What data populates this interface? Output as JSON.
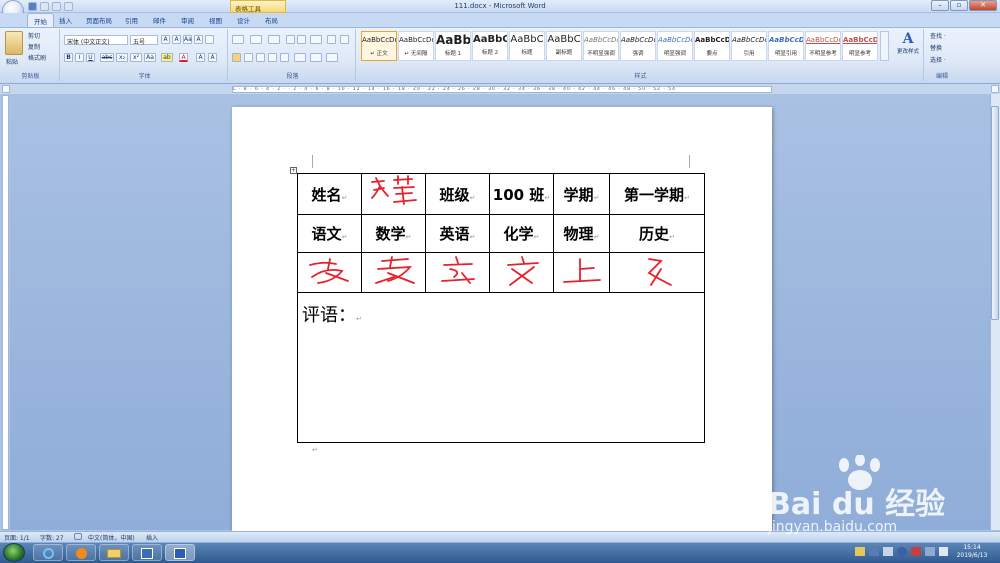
{
  "window": {
    "title": "111.docx - Microsoft Word",
    "context_tab": "表格工具",
    "minimize": "–",
    "restore": "▫",
    "close": "✕"
  },
  "tabs": [
    "开始",
    "插入",
    "页面布局",
    "引用",
    "邮件",
    "审阅",
    "视图",
    "设计",
    "布局"
  ],
  "clipboard": {
    "paste": "粘贴",
    "cut": "剪切",
    "copy": "复制",
    "format_painter": "格式刷",
    "label": "剪贴板"
  },
  "font": {
    "name": "宋体 (中文正文)",
    "size": "五号",
    "label": "字体",
    "bold": "B",
    "italic": "I",
    "underline": "U",
    "strike": "abc",
    "sub": "x₂",
    "sup": "x²",
    "aa": "Aa",
    "grow": "A",
    "shrink": "A",
    "clear": "A",
    "highlight": "ab",
    "color": "A",
    "char_border": "A"
  },
  "paragraph": {
    "label": "段落"
  },
  "styles": {
    "label": "样式",
    "items": [
      {
        "sample": "AaBbCcDd",
        "name": "↵ 正文"
      },
      {
        "sample": "AaBbCcDd",
        "name": "↵ 无间隔"
      },
      {
        "sample": "AaBb",
        "name": "标题 1"
      },
      {
        "sample": "AaBbC",
        "name": "标题 2"
      },
      {
        "sample": "AaBbC",
        "name": "标题"
      },
      {
        "sample": "AaBbC",
        "name": "副标题"
      },
      {
        "sample": "AaBbCcDd",
        "name": "不明显强调"
      },
      {
        "sample": "AaBbCcDd",
        "name": "强调"
      },
      {
        "sample": "AaBbCcDd",
        "name": "明显强调"
      },
      {
        "sample": "AaBbCcDd",
        "name": "要点"
      },
      {
        "sample": "AaBbCcDd",
        "name": "引用"
      },
      {
        "sample": "AaBbCcDd",
        "name": "明显引用"
      },
      {
        "sample": "AaBbCcDd",
        "name": "不明显参考"
      },
      {
        "sample": "AaBbCcDd",
        "name": "明显参考"
      }
    ],
    "change_styles": "更改样式"
  },
  "editing": {
    "find": "查找 ·",
    "replace": "替换",
    "select": "选择 ·",
    "label": "编辑"
  },
  "ruler_text": "L · 8 · 6 · 4 · 2 · · 2 · 4 · 6 · 8 · 10 · 12 · 14 · 16 · 18 · 20 · 22 · 24 · 26 · 28 · 30 · 32 · 34 · 36 · 38 · 40 · 42 · 44 · 46 · 48 · 50 · 52 · 54",
  "table": {
    "row1": [
      "姓名",
      "",
      "班级",
      "100 班",
      "学期",
      "第一学期"
    ],
    "row2": [
      "语文",
      "数学",
      "英语",
      "化学",
      "物理",
      "历史"
    ],
    "signature_labels": [
      "安",
      "良",
      "言",
      "文",
      "上",
      "乂"
    ],
    "comment_label": "评语：",
    "cell_mark": "↵",
    "para_mark": "↵",
    "handwriting_color": "#e8202a"
  },
  "status": {
    "page": "页面: 1/1",
    "words": "字数: 27",
    "lang": "中文(简体，中国)",
    "mode": "插入"
  },
  "taskbar": {
    "time": "15:14",
    "date": "2019/6/13"
  },
  "watermark": {
    "brand": "Bai du 经验",
    "url": "jingyan.baidu.com"
  }
}
